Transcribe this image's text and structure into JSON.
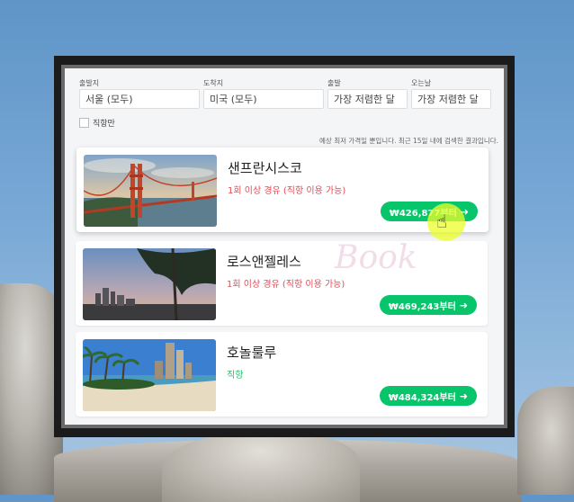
{
  "search": {
    "origin": {
      "label": "출발지",
      "value": "서울 (모두)"
    },
    "destination": {
      "label": "도착지",
      "value": "미국 (모두)"
    },
    "depart": {
      "label": "출발",
      "value": "가장 저렴한 달"
    },
    "return": {
      "label": "오는날",
      "value": "가장 저렴한 달"
    },
    "direct_only": {
      "label": "직항만",
      "checked": false
    }
  },
  "notice": "예상 최저 가격일 뿐입니다. 최근 15일 내에 검색한 결과입니다.",
  "results": [
    {
      "city": "샌프란시스코",
      "route": "1회 이상 경유 (직항 이용 가능)",
      "route_type": "stop",
      "price": "₩426,877부터",
      "image_icon": "golden-gate-bridge"
    },
    {
      "city": "로스앤젤레스",
      "route": "1회 이상 경유 (직항 이용 가능)",
      "route_type": "stop",
      "price": "₩469,243부터",
      "image_icon": "la-skyline"
    },
    {
      "city": "호놀룰루",
      "route": "직항",
      "route_type": "direct",
      "price": "₩484,324부터",
      "image_icon": "honolulu-beach"
    }
  ],
  "colors": {
    "accent": "#08c46b",
    "stop_text": "#e84a55",
    "direct_text": "#2bbf6a",
    "highlight": "#ecff28"
  },
  "watermark": "Book"
}
